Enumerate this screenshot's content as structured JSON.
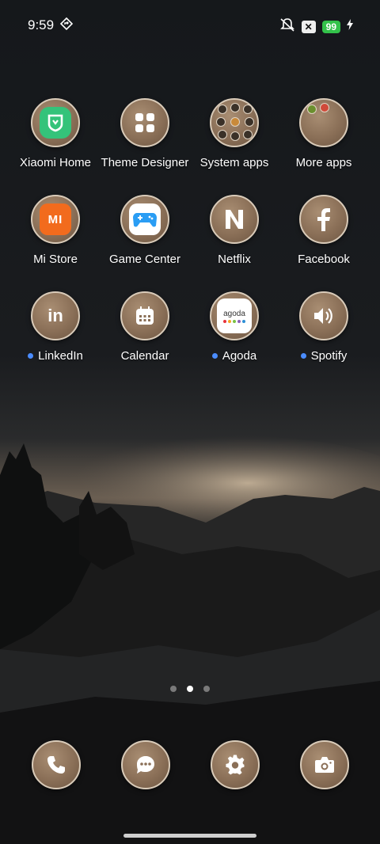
{
  "status_bar": {
    "time": "9:59",
    "battery": "99",
    "icons": [
      "diamond-location-icon",
      "silent-icon",
      "x-box-icon",
      "battery-icon",
      "charging-bolt-icon"
    ]
  },
  "apps": [
    {
      "label": "Xiaomi Home",
      "icon": "mi-home-icon",
      "badge": false
    },
    {
      "label": "Theme Designer",
      "icon": "four-squares-icon",
      "badge": false
    },
    {
      "label": "System apps",
      "icon": "folder-icon",
      "badge": false
    },
    {
      "label": "More apps",
      "icon": "folder-icon",
      "badge": false
    },
    {
      "label": "Mi Store",
      "icon": "mi-logo-icon",
      "badge": false
    },
    {
      "label": "Game Center",
      "icon": "gamepad-icon",
      "badge": false
    },
    {
      "label": "Netflix",
      "icon": "netflix-n-icon",
      "badge": false
    },
    {
      "label": "Facebook",
      "icon": "facebook-f-icon",
      "badge": false
    },
    {
      "label": "LinkedIn",
      "icon": "linkedin-in-icon",
      "badge": true
    },
    {
      "label": "Calendar",
      "icon": "calendar-icon",
      "badge": false
    },
    {
      "label": "Agoda",
      "icon": "agoda-logo-icon",
      "badge": true
    },
    {
      "label": "Spotify",
      "icon": "speaker-icon",
      "badge": true
    }
  ],
  "agoda_logo_text": "agoda",
  "mi_logo_text": "MI",
  "pager": {
    "pages": 3,
    "current": 2
  },
  "dock": [
    "phone-icon",
    "messages-icon",
    "settings-gear-icon",
    "camera-icon"
  ],
  "colors": {
    "badge_dot": "#4a8cff",
    "battery": "#33c24a",
    "icon_tint": "#8a6f57"
  }
}
